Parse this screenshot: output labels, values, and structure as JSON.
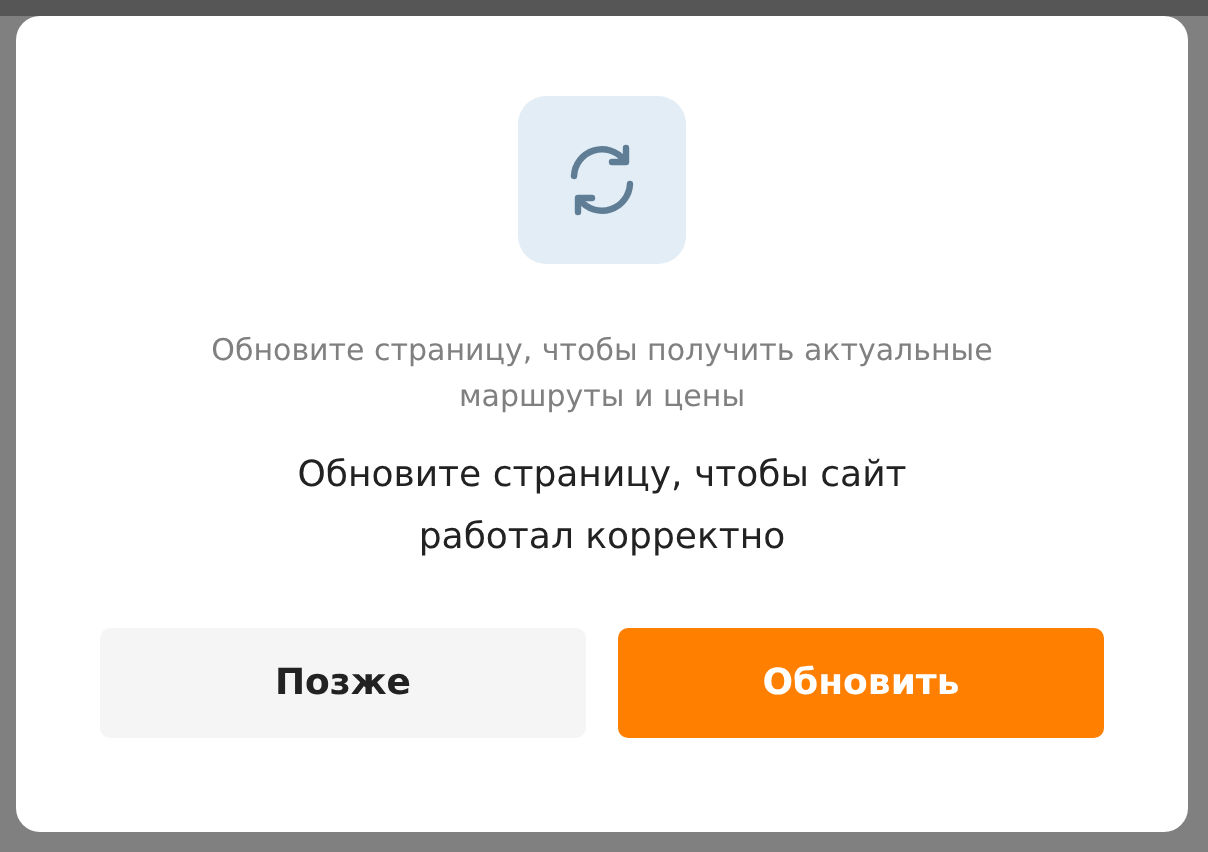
{
  "dialog": {
    "hint": "Обновите страницу, чтобы получить актуальные маршруты и цены",
    "message": "Обновите страницу, чтобы сайт работал корректно",
    "buttons": [
      {
        "label": "Позже",
        "kind": "secondary"
      },
      {
        "label": "Обновить",
        "kind": "primary"
      }
    ]
  }
}
